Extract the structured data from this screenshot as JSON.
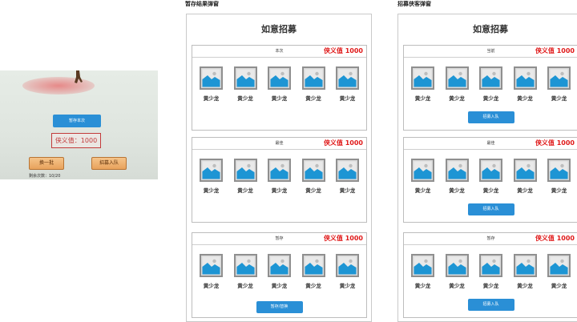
{
  "captions": {
    "left": "暂存结果弹窗",
    "right": "招募侠客弹窗"
  },
  "preview": {
    "save_button": "暂存本次",
    "value_text": "侠义值：1000",
    "swap_button": "换一批",
    "recruit_button": "招募入队",
    "remaining": "剩余次数：10/20"
  },
  "panels": [
    {
      "title": "如意招募",
      "sections": [
        {
          "label": "本次",
          "value": "侠义值 1000",
          "heroes": [
            "黄少龙",
            "黄少龙",
            "黄少龙",
            "黄少龙",
            "黄少龙"
          ],
          "button": ""
        },
        {
          "label": "最佳",
          "value": "侠义值 1000",
          "heroes": [
            "黄少龙",
            "黄少龙",
            "黄少龙",
            "黄少龙",
            "黄少龙"
          ],
          "button": ""
        },
        {
          "label": "暂存",
          "value": "侠义值 1000",
          "heroes": [
            "黄少龙",
            "黄少龙",
            "黄少龙",
            "黄少龙",
            "黄少龙"
          ],
          "button": "暂存/替换"
        }
      ]
    },
    {
      "title": "如意招募",
      "sections": [
        {
          "label": "当前",
          "value": "侠义值 1000",
          "heroes": [
            "黄少龙",
            "黄少龙",
            "黄少龙",
            "黄少龙",
            "黄少龙"
          ],
          "button": "招募入队"
        },
        {
          "label": "最佳",
          "value": "侠义值 1000",
          "heroes": [
            "黄少龙",
            "黄少龙",
            "黄少龙",
            "黄少龙",
            "黄少龙"
          ],
          "button": "招募入队"
        },
        {
          "label": "暂存",
          "value": "侠义值 1000",
          "heroes": [
            "黄少龙",
            "黄少龙",
            "黄少龙",
            "黄少龙",
            "黄少龙"
          ],
          "button": "招募入队"
        }
      ]
    }
  ],
  "icons": {
    "hero_thumb": "image-placeholder-icon"
  },
  "colors": {
    "accent_blue": "#2a8fd6",
    "value_red": "#e01b1b"
  }
}
